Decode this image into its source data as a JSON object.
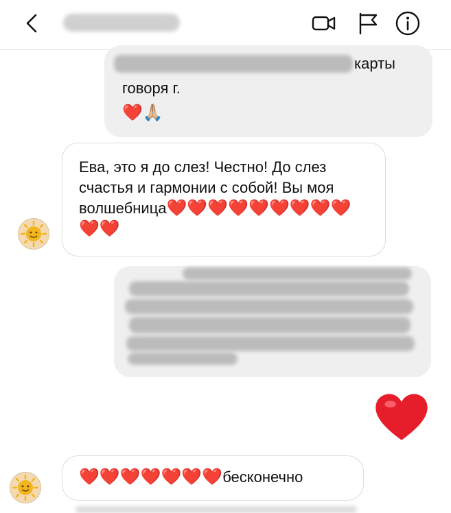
{
  "header": {
    "back_icon": "chevron-left-icon",
    "video_icon": "video-camera-icon",
    "flag_icon": "flag-icon",
    "info_icon": "info-icon"
  },
  "messages": {
    "m1": {
      "visible_end": "карты",
      "line2": "говоря г.",
      "emoji": "❤️🙏🏼"
    },
    "m2": {
      "text": "Ева, это я до слез! Честно! До слез счастья и гармонии с собой! Вы моя волшебница",
      "hearts": "❤️❤️❤️❤️❤️❤️❤️❤️❤️❤️❤️"
    },
    "m3": {
      "redacted": true
    },
    "m4": {
      "emoji": "❤️"
    },
    "m5": {
      "hearts": "❤️❤️❤️❤️❤️❤️❤️",
      "text": "бесконечно"
    }
  },
  "colors": {
    "heart": "#e61e2b",
    "bubble_out": "#efefef",
    "bubble_in_border": "#dcdcdc"
  }
}
